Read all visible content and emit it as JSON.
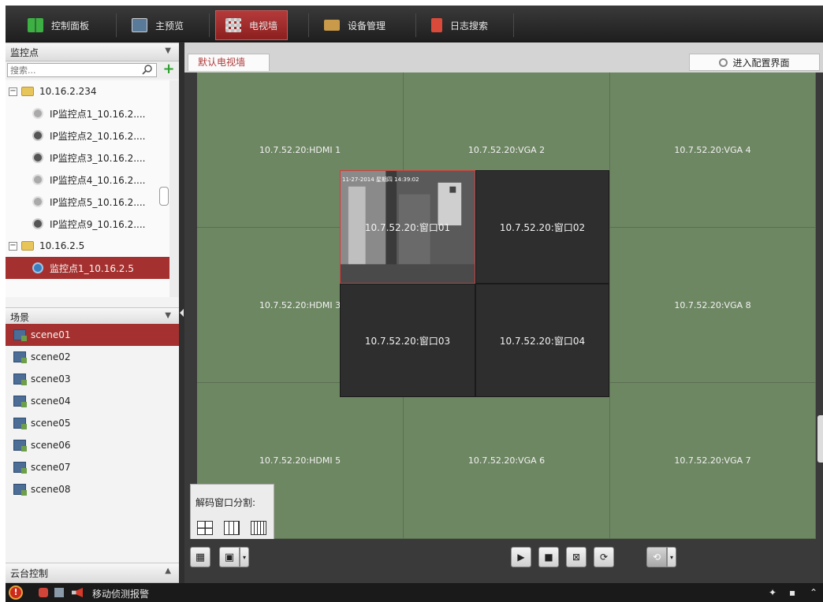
{
  "nav": {
    "tabs": [
      {
        "label": "控制面板",
        "icon": "grid-icon"
      },
      {
        "label": "主预览",
        "icon": "preview-icon"
      },
      {
        "label": "电视墙",
        "icon": "tv-wall-icon",
        "active": true
      },
      {
        "label": "设备管理",
        "icon": "device-icon"
      },
      {
        "label": "日志搜索",
        "icon": "log-icon"
      }
    ]
  },
  "left": {
    "monitor_title": "监控点",
    "search_placeholder": "搜索...",
    "tree": [
      {
        "label": "10.16.2.234",
        "type": "folder"
      },
      {
        "label": "IP监控点1_10.16.2....",
        "type": "ip-camera"
      },
      {
        "label": "IP监控点2_10.16.2....",
        "type": "camera"
      },
      {
        "label": "IP监控点3_10.16.2....",
        "type": "camera"
      },
      {
        "label": "IP监控点4_10.16.2....",
        "type": "ip-camera"
      },
      {
        "label": "IP监控点5_10.16.2....",
        "type": "ip-camera"
      },
      {
        "label": "IP监控点9_10.16.2....",
        "type": "camera"
      },
      {
        "label": "10.16.2.5",
        "type": "folder"
      },
      {
        "label": "监控点1_10.16.2.5",
        "type": "camera",
        "selected": true
      }
    ],
    "scene_title": "场景",
    "scenes": [
      "scene01",
      "scene02",
      "scene03",
      "scene04",
      "scene05",
      "scene06",
      "scene07",
      "scene08"
    ],
    "ptz_title": "云台控制"
  },
  "main": {
    "tab_label": "默认电视墙",
    "config_label": "进入配置界面",
    "screens": [
      "10.7.52.20:HDMI 1",
      "10.7.52.20:VGA 2",
      "10.7.52.20:VGA 4",
      "10.7.52.20:HDMI 3",
      "10.7.52.20:VGA 8",
      "10.7.52.20:HDMI 5",
      "10.7.52.20:VGA 6",
      "10.7.52.20:VGA 7"
    ],
    "windows": [
      "10.7.52.20:窗口01",
      "10.7.52.20:窗口02",
      "10.7.52.20:窗口03",
      "10.7.52.20:窗口04"
    ],
    "video_timestamp": "11-27-2014 星期四 14:39:02",
    "split_label": "解码窗口分割:"
  },
  "status": {
    "alarm_text": "移动侦测报警"
  },
  "colors": {
    "accent": "#a4312f",
    "wall": "#6e8763",
    "window": "#2e2e2e"
  }
}
